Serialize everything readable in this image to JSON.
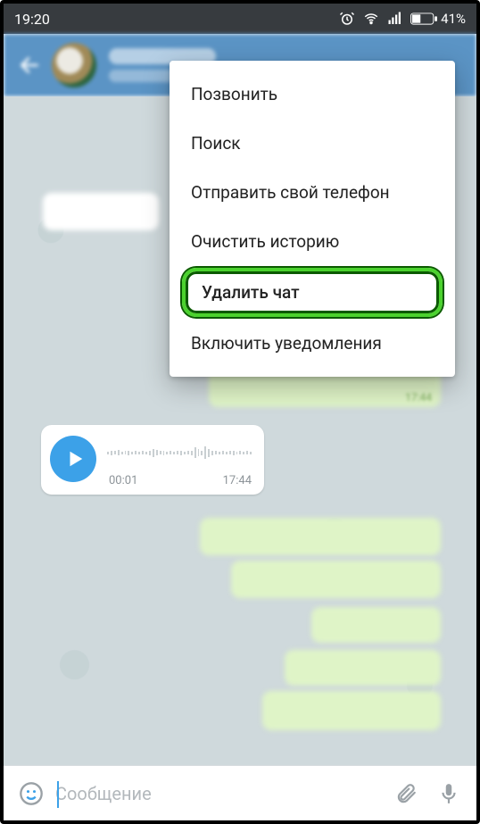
{
  "statusbar": {
    "time": "19:20",
    "battery_pct": "41%"
  },
  "menu": {
    "items": [
      "Позвонить",
      "Поиск",
      "Отправить свой телефон",
      "Очистить историю",
      "Удалить чат",
      "Включить уведомления"
    ],
    "highlighted_index": 4
  },
  "voice": {
    "duration": "00:01",
    "time": "17:44"
  },
  "bubble_times": {
    "t1": "17:44"
  },
  "input": {
    "placeholder": "Сообщение"
  }
}
